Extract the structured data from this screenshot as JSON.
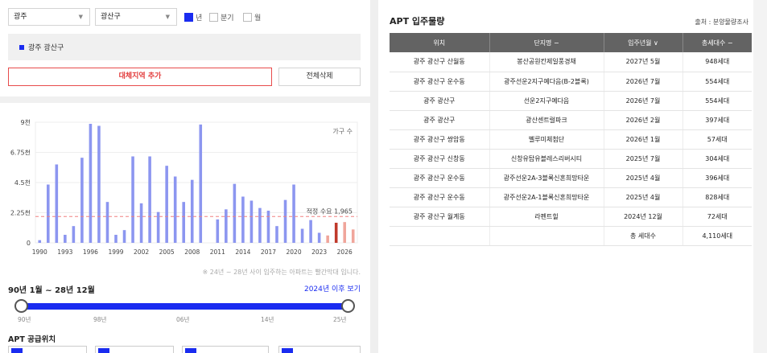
{
  "filters": {
    "city": "광주",
    "district": "광산구",
    "period_options": [
      {
        "label": "년",
        "checked": true
      },
      {
        "label": "분기",
        "checked": false
      },
      {
        "label": "월",
        "checked": false
      }
    ]
  },
  "region_tag": "광주 광산구",
  "buttons": {
    "add_region": "대체지역 추가",
    "delete_all": "전체삭제"
  },
  "chart_data": {
    "type": "bar",
    "y_ticks": [
      "0",
      "2.25천",
      "4.5천",
      "6.75천",
      "9천"
    ],
    "ylim": [
      0,
      9000
    ],
    "x_tick_labels": [
      "1990",
      "1993",
      "1996",
      "1999",
      "2002",
      "2005",
      "2008",
      "2011",
      "2014",
      "2017",
      "2020",
      "2023",
      "2026"
    ],
    "years": [
      1990,
      1991,
      1992,
      1993,
      1994,
      1995,
      1996,
      1997,
      1998,
      1999,
      2000,
      2001,
      2002,
      2003,
      2004,
      2005,
      2006,
      2007,
      2008,
      2009,
      2010,
      2011,
      2012,
      2013,
      2014,
      2015,
      2016,
      2017,
      2018,
      2019,
      2020,
      2021,
      2022,
      2023,
      2024,
      2025,
      2026,
      2027
    ],
    "values": [
      200,
      4350,
      5850,
      600,
      1250,
      6350,
      8880,
      8730,
      3050,
      600,
      950,
      6450,
      2950,
      6450,
      2300,
      5750,
      4950,
      3050,
      4700,
      8830,
      0,
      1750,
      2500,
      4400,
      3450,
      3150,
      2600,
      2400,
      1250,
      3200,
      4350,
      1050,
      1700,
      750,
      550,
      1500,
      1550,
      1000
    ],
    "future_from": 2024,
    "legend_label": "가구 수",
    "reference": {
      "label": "적정 수요 1,965",
      "value": 1965
    },
    "colors": {
      "past": "#8c96f0",
      "future": "#f0a59b",
      "highlight": "#c0392b",
      "reference": "#f08080"
    }
  },
  "chart_note": "※ 24년 ~ 28년 사이 입주하는 아파트는 빨간막대 입니다.",
  "range": {
    "title": "90년 1월 ~ 28년 12월",
    "link": "2024년 이후 보기",
    "ticks": [
      "90년",
      "98년",
      "06년",
      "14년",
      "25년"
    ]
  },
  "supply_title": "APT 공급위치",
  "apt": {
    "title": "APT 입주물량",
    "source": "출처 : 분양물량조사",
    "columns": [
      "위치",
      "단지명 −",
      "입주년월 ∨",
      "총세대수 −"
    ],
    "rows": [
      [
        "광주 광산구 산월동",
        "봉산공원칸제일풍경채",
        "2027년 5월",
        "948세대"
      ],
      [
        "광주 광산구 운수동",
        "광주선운2지구예다음(B-2블록)",
        "2026년 7월",
        "554세대"
      ],
      [
        "광주 광산구",
        "선운2지구예다음",
        "2026년 7월",
        "554세대"
      ],
      [
        "광주 광산구",
        "광산센트럴파크",
        "2026년 2월",
        "397세대"
      ],
      [
        "광주 광산구 쌍암동",
        "벨루미체첨단",
        "2026년 1월",
        "57세대"
      ],
      [
        "광주 광산구 신창동",
        "신창유탑유블레스리버시티",
        "2025년 7월",
        "304세대"
      ],
      [
        "광주 광산구 운수동",
        "광주선운2A-3블록신혼희망타운",
        "2025년 4월",
        "396세대"
      ],
      [
        "광주 광산구 운수동",
        "광주선운2A-1블록신혼희망타운",
        "2025년 4월",
        "828세대"
      ],
      [
        "광주 광산구 월계동",
        "라펜트힐",
        "2024년 12월",
        "72세대"
      ]
    ],
    "total_label": "총 세대수",
    "total_value": "4,110세대"
  }
}
